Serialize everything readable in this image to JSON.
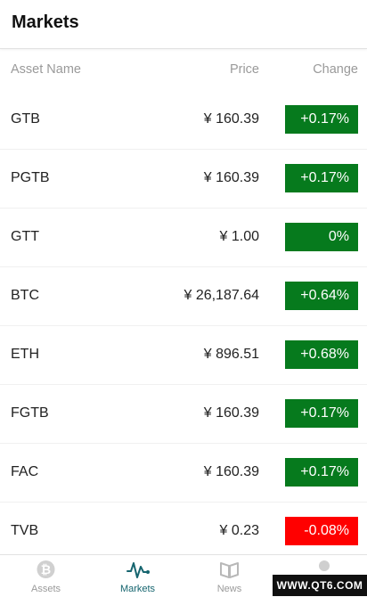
{
  "header": {
    "title": "Markets"
  },
  "columns": {
    "name": "Asset Name",
    "price": "Price",
    "change": "Change"
  },
  "colors": {
    "up": "#067a1d",
    "down": "#ff0000",
    "flat": "#067a1d",
    "active_tab": "#16656f"
  },
  "rows": [
    {
      "name": "GTB",
      "price": "¥ 160.39",
      "change": "+0.17%",
      "trend": "up"
    },
    {
      "name": "PGTB",
      "price": "¥ 160.39",
      "change": "+0.17%",
      "trend": "up"
    },
    {
      "name": "GTT",
      "price": "¥ 1.00",
      "change": "0%",
      "trend": "flat"
    },
    {
      "name": "BTC",
      "price": "¥ 26,187.64",
      "change": "+0.64%",
      "trend": "up"
    },
    {
      "name": "ETH",
      "price": "¥ 896.51",
      "change": "+0.68%",
      "trend": "up"
    },
    {
      "name": "FGTB",
      "price": "¥ 160.39",
      "change": "+0.17%",
      "trend": "up"
    },
    {
      "name": "FAC",
      "price": "¥ 160.39",
      "change": "+0.17%",
      "trend": "up"
    },
    {
      "name": "TVB",
      "price": "¥ 0.23",
      "change": "-0.08%",
      "trend": "down"
    }
  ],
  "tabs": [
    {
      "label": "Assets",
      "icon": "bitcoin-icon",
      "active": false
    },
    {
      "label": "Markets",
      "icon": "pulse-icon",
      "active": true
    },
    {
      "label": "News",
      "icon": "book-icon",
      "active": false
    },
    {
      "label": "",
      "icon": "profile-icon",
      "active": false
    }
  ],
  "watermark": "WWW.QT6.COM"
}
